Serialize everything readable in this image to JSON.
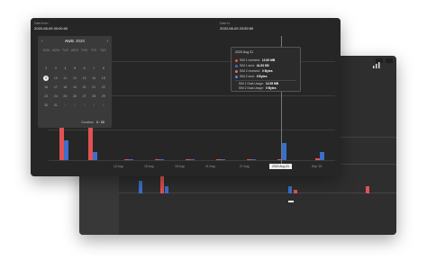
{
  "back_window": {
    "tabs": [
      "",
      ""
    ],
    "x_labels": [
      "",
      "",
      "",
      "",
      "",
      "",
      "",
      "",
      ""
    ],
    "tooltip_label": "",
    "right_info": [
      "",
      "",
      "",
      ""
    ],
    "chart_icon": "bar-chart-icon"
  },
  "header": {
    "from_label": "Date from",
    "from_value": "2020-08-09 00:00:00",
    "to_label": "Date to",
    "to_value": "2020-08-09 23:59:59"
  },
  "calendar": {
    "prev": "‹",
    "next": "›",
    "month": "AUG",
    "year": "2020",
    "weekdays": [
      "SUN",
      "MON",
      "TUE",
      "WED",
      "THU",
      "FRI",
      "SAT"
    ],
    "weeks": [
      [
        "",
        "",
        "",
        "",
        "",
        "",
        ""
      ],
      [
        "2",
        "3",
        "4",
        "5",
        "6",
        "7",
        "8"
      ],
      [
        "9",
        "10",
        "11",
        "12",
        "13",
        "14",
        "15"
      ],
      [
        "16",
        "17",
        "18",
        "19",
        "20",
        "21",
        "22"
      ],
      [
        "23",
        "24",
        "25",
        "26",
        "27",
        "28",
        "29"
      ],
      [
        "30",
        "31",
        "1",
        "2",
        "3",
        "4",
        "5"
      ]
    ],
    "selected_day": "9",
    "time_label": "Duration",
    "time_value": "0 : 00"
  },
  "tooltip": {
    "title": "2020 Aug 31",
    "rows": [
      {
        "label": "SIM 1 received:",
        "value": "12.00 MB",
        "color": "#e05252"
      },
      {
        "label": "SIM 1 sent:",
        "value": "41.53 KB",
        "color": "#3b6fc9"
      },
      {
        "label": "SIM 2 received:",
        "value": "0 Bytes",
        "color": "#e0705a"
      },
      {
        "label": "SIM 2 sent:",
        "value": "0 Bytes",
        "color": "#4a90d9"
      }
    ],
    "usage_rows": [
      {
        "label": "SIM 1 Data Usage:",
        "value": "12.05 MB"
      },
      {
        "label": "SIM 2 Data Usage:",
        "value": "0 Bytes"
      }
    ]
  },
  "chart": {
    "y_labels": [
      "",
      ""
    ],
    "x_labels": [
      "",
      "12 Aug",
      "15 Aug",
      "18 Aug",
      "21 Aug",
      "24 Aug",
      "27 Aug",
      "2020 Aug 31",
      "Sep '20"
    ],
    "hover_label": "2020 Aug 31",
    "colors": {
      "received": "#e05252",
      "sent": "#3b6fc9"
    }
  },
  "chart_data": {
    "type": "bar",
    "series": [
      {
        "values": [
          62,
          36,
          0.5,
          0.3,
          0.3,
          0.2,
          0.2,
          0.6,
          1.0
        ]
      },
      {
        "values": [
          14,
          6,
          0.4,
          0.3,
          0.2,
          0.2,
          0.2,
          12,
          6
        ]
      }
    ]
  }
}
